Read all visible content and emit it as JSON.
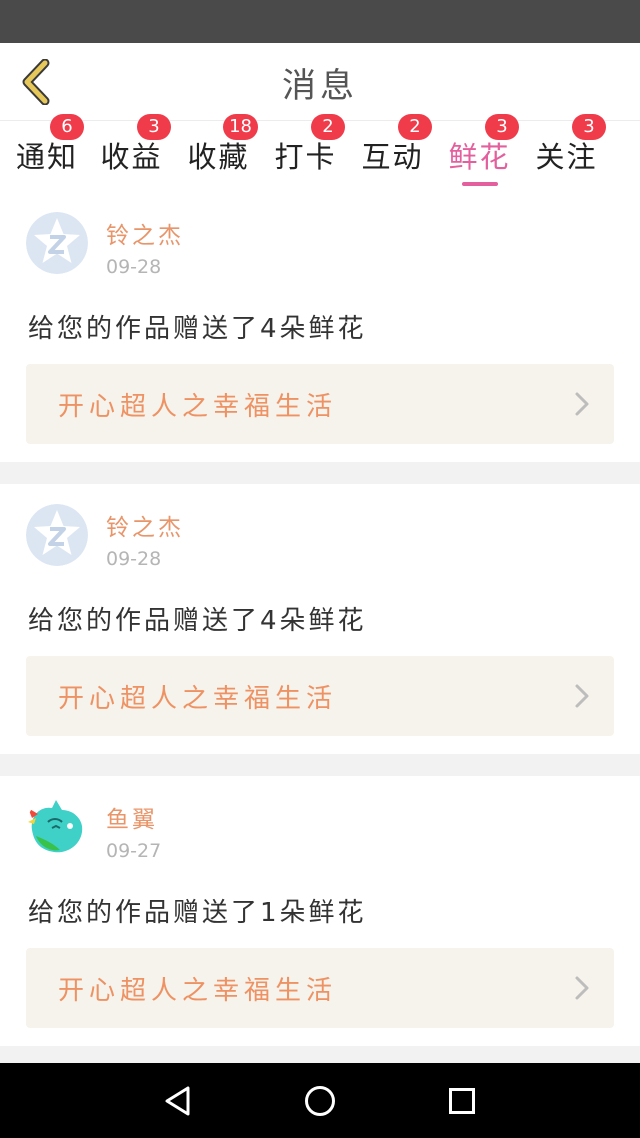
{
  "header": {
    "title": "消息"
  },
  "tabs": [
    {
      "label": "通知",
      "badge": "6",
      "active": false
    },
    {
      "label": "收益",
      "badge": "3",
      "active": false
    },
    {
      "label": "收藏",
      "badge": "18",
      "active": false
    },
    {
      "label": "打卡",
      "badge": "2",
      "active": false
    },
    {
      "label": "互动",
      "badge": "2",
      "active": false
    },
    {
      "label": "鲜花",
      "badge": "3",
      "active": true
    },
    {
      "label": "关注",
      "badge": "3",
      "active": false
    }
  ],
  "messages": [
    {
      "username": "铃之杰",
      "date": "09-28",
      "text": "给您的作品赠送了4朵鲜花",
      "work_title": "开心超人之幸福生活",
      "avatar": "qq-default-avatar"
    },
    {
      "username": "铃之杰",
      "date": "09-28",
      "text": "给您的作品赠送了4朵鲜花",
      "work_title": "开心超人之幸福生活",
      "avatar": "qq-default-avatar"
    },
    {
      "username": "鱼翼",
      "date": "09-27",
      "text": "给您的作品赠送了1朵鲜花",
      "work_title": "开心超人之幸福生活",
      "avatar": "cartoon-avatar"
    }
  ],
  "icons": {
    "back": "chevron-left-icon",
    "chevron": "chevron-right-icon",
    "nav_back": "triangle-back-icon",
    "nav_home": "circle-home-icon",
    "nav_recents": "square-recents-icon"
  },
  "colors": {
    "accent": "#e35f9d",
    "badge": "#f03c4a",
    "username": "#e8956a",
    "work_title": "#ee9263",
    "back_arrow": "#d8b84a"
  }
}
